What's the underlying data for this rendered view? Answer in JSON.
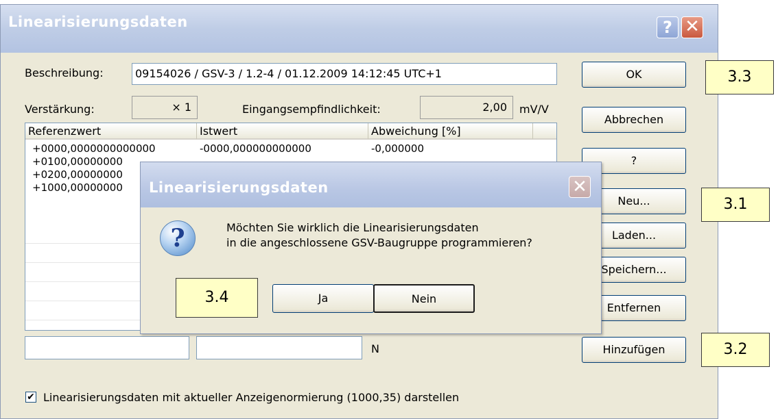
{
  "window": {
    "title": "Linearisierungsdaten",
    "help_glyph": "?",
    "close_glyph": "✕"
  },
  "form": {
    "description_label": "Beschreibung:",
    "description_value": "09154026 / GSV-3 / 1.2-4 / 01.12.2009 14:12:45 UTC+1",
    "gain_label": "Verstärkung:",
    "gain_value": "× 1",
    "sensitivity_label": "Eingangsempfindlichkeit:",
    "sensitivity_value": "2,00",
    "sensitivity_unit": "mV/V",
    "unit_label": "N",
    "checkbox_label": "Linearisierungsdaten mit aktueller Anzeigenormierung (1000,35) darstellen",
    "checkbox_checked": true
  },
  "table": {
    "columns": [
      "Referenzwert",
      "Istwert",
      "Abweichung [%]"
    ],
    "rows": [
      {
        "ref": "+0000,0000000000000",
        "ist": "-0000,000000000000",
        "abw": "-0,000000"
      },
      {
        "ref": "+0100,00000000",
        "ist": "",
        "abw": ""
      },
      {
        "ref": "+0200,00000000",
        "ist": "",
        "abw": ""
      },
      {
        "ref": "+1000,00000000",
        "ist": "",
        "abw": ""
      }
    ]
  },
  "buttons": {
    "ok": "OK",
    "cancel": "Abbrechen",
    "help": "?",
    "new": "Neu...",
    "load": "Laden...",
    "save": "Speichern...",
    "remove": "Entfernen",
    "add": "Hinzufügen"
  },
  "callouts": {
    "ok": "3.3",
    "new": "3.1",
    "add": "3.2",
    "dialog": "3.4"
  },
  "dialog": {
    "title": "Linearisierungsdaten",
    "message_line1": "Möchten Sie wirklich die Linearisierungsdaten",
    "message_line2": "in die angeschlossene GSV-Baugruppe programmieren?",
    "yes": "Ja",
    "no": "Nein",
    "icon_glyph": "?"
  }
}
